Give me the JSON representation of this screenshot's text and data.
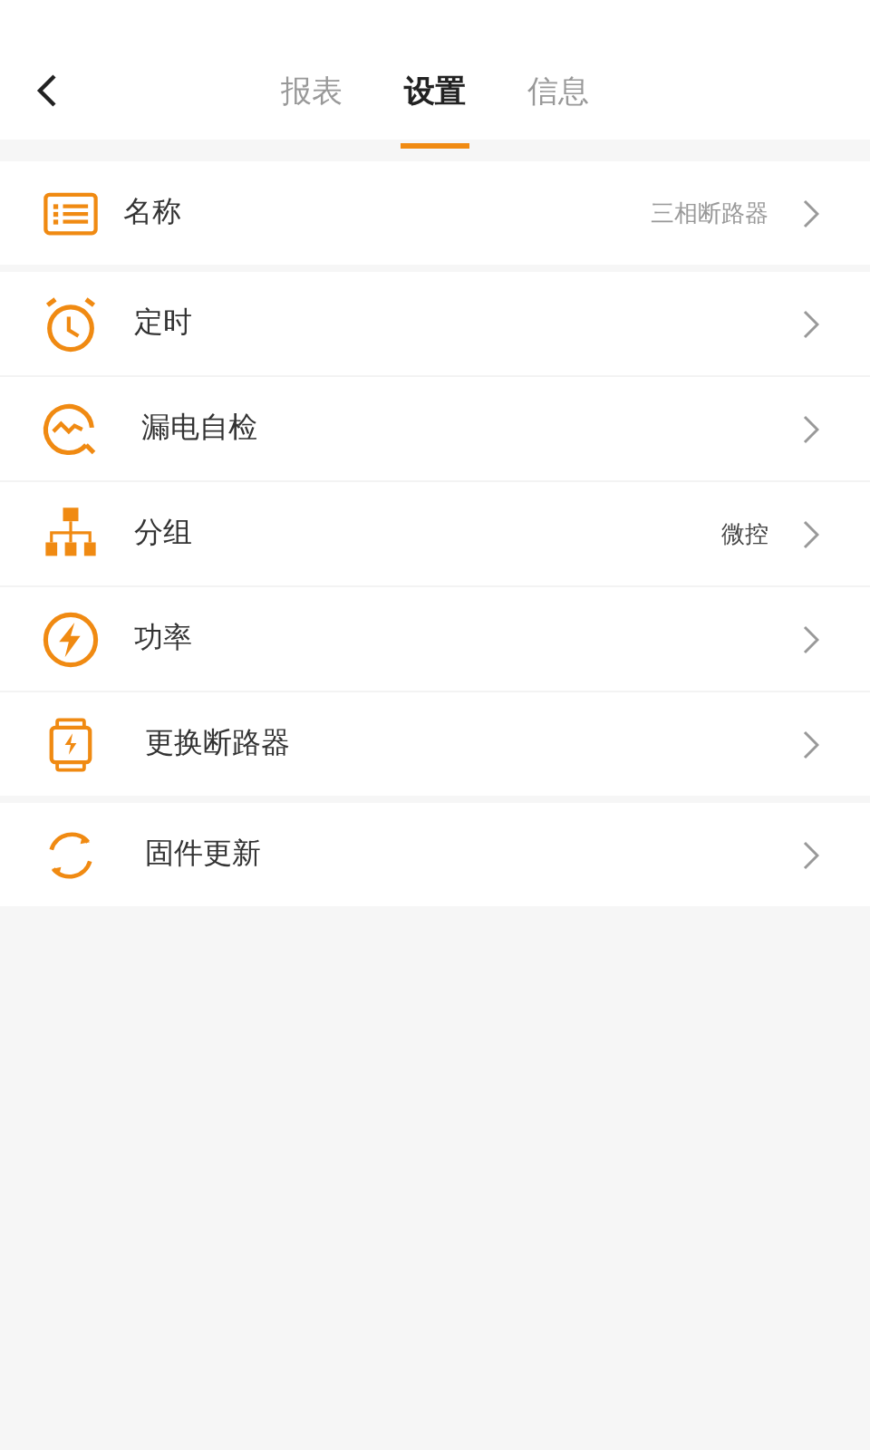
{
  "tabs": [
    {
      "label": "报表",
      "selected": false
    },
    {
      "label": "设置",
      "selected": true
    },
    {
      "label": "信息",
      "selected": false
    }
  ],
  "sections": [
    [
      {
        "label": "名称",
        "value": "三相断路器"
      }
    ],
    [
      {
        "label": "定时"
      },
      {
        "label": "漏电自检"
      },
      {
        "label": "分组",
        "value": "微控"
      },
      {
        "label": "功率"
      },
      {
        "label": "更换断路器"
      }
    ],
    [
      {
        "label": "固件更新"
      }
    ]
  ]
}
